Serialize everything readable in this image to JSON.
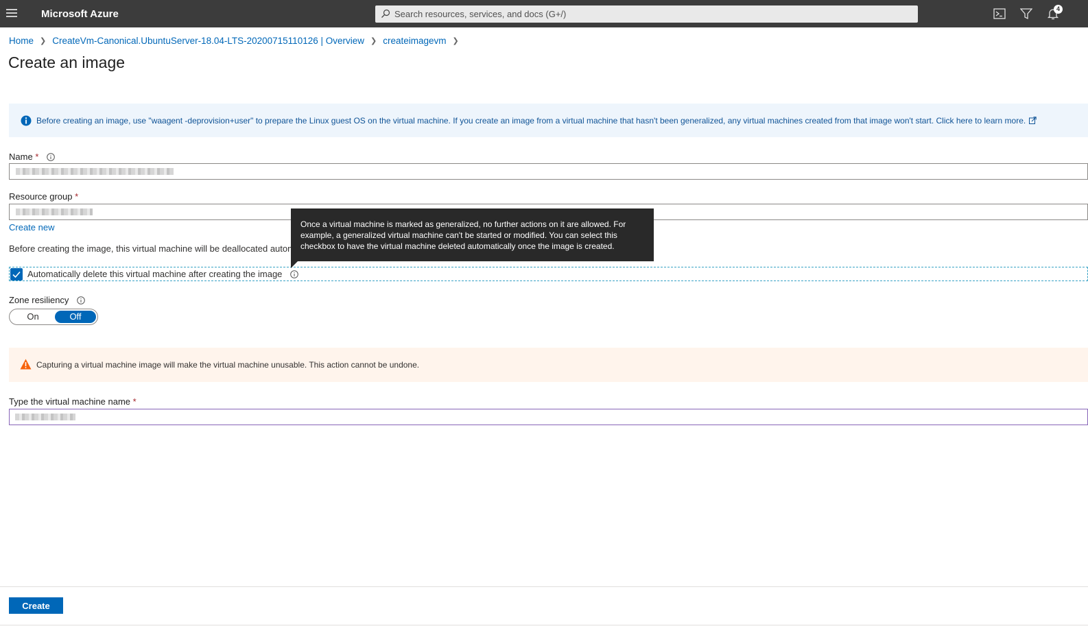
{
  "topbar": {
    "brand": "Microsoft Azure",
    "search_placeholder": "Search resources, services, and docs (G+/)",
    "notification_count": "4",
    "bg_color": "#3c3c3c"
  },
  "breadcrumb": [
    "Home",
    "CreateVm-Canonical.UbuntuServer-18.04-LTS-20200715110126 | Overview",
    "createimagevm"
  ],
  "page": {
    "title": "Create an image"
  },
  "info_banner": {
    "text": "Before creating an image, use \"waagent -deprovision+user\" to prepare the Linux guest OS on the virtual machine. If you create an image from a virtual machine that hasn't been generalized, any virtual machines created from that image won't start. Click here to learn more."
  },
  "form": {
    "name_label": "Name",
    "resource_group_label": "Resource group",
    "create_new_link": "Create new",
    "dealloc_text": "Before creating the image, this virtual machine will be deallocated automatically.",
    "auto_delete_label": "Automatically delete this virtual machine after creating the image",
    "auto_delete_checked": true,
    "zone_resiliency_label": "Zone resiliency",
    "zone_on": "On",
    "zone_off": "Off",
    "zone_selected": "Off",
    "vm_name_label": "Type the virtual machine name",
    "required_mark": "*"
  },
  "warning_banner": {
    "text": "Capturing a virtual machine image will make the virtual machine unusable. This action cannot be undone."
  },
  "tooltip": {
    "text": "Once a virtual machine is marked as generalized, no further actions on it are allowed. For example, a generalized virtual machine can't be started or modified. You can select this checkbox to have the virtual machine deleted automatically once the image is created."
  },
  "footer": {
    "create_button": "Create"
  },
  "colors": {
    "accent": "#0067b8",
    "link": "#0067b8",
    "required": "#a4262c",
    "warning_icon": "#f7630c",
    "info_icon": "#0067b8"
  },
  "icons": [
    "hamburger-icon",
    "search-icon",
    "cloud-shell-icon",
    "directory-filter-icon",
    "notifications-icon",
    "info-icon",
    "external-link-icon",
    "checkmark-icon",
    "warning-icon",
    "chevron-right-icon"
  ]
}
